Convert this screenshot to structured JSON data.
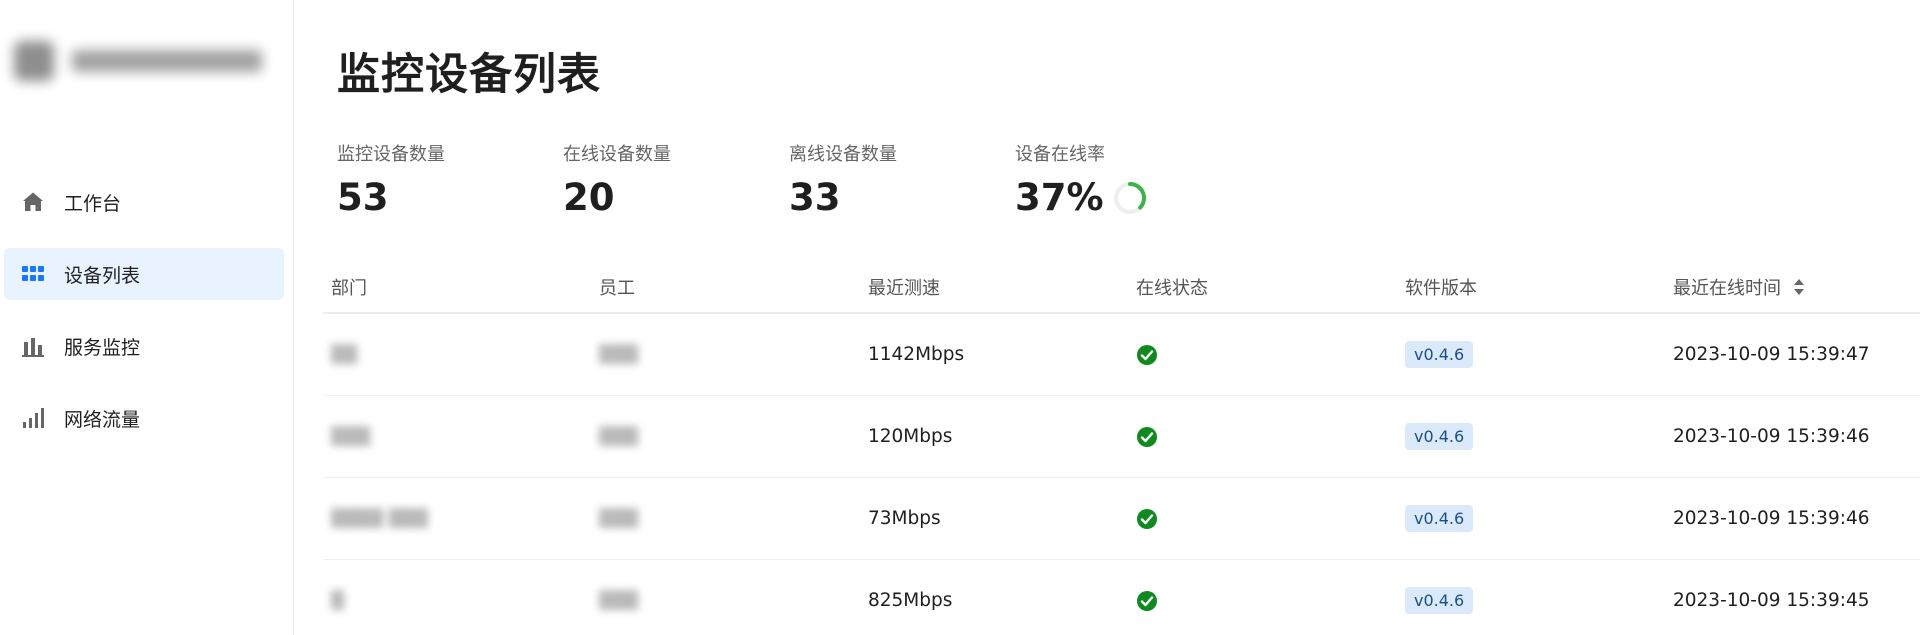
{
  "sidebar": {
    "logo_text": "",
    "items": [
      {
        "label": "工作台",
        "icon": "home-icon",
        "active": false
      },
      {
        "label": "设备列表",
        "icon": "grid-icon",
        "active": true
      },
      {
        "label": "服务监控",
        "icon": "bar-chart-icon",
        "active": false
      },
      {
        "label": "网络流量",
        "icon": "signal-icon",
        "active": false
      }
    ]
  },
  "colors": {
    "accent": "#1677ff",
    "active_bg": "#e8f3ff",
    "success": "#0f8a1e",
    "ring": "#3cb34a",
    "badge_bg": "#dbeafb"
  },
  "page": {
    "title": "监控设备列表"
  },
  "stats": [
    {
      "label": "监控设备数量",
      "value": "53"
    },
    {
      "label": "在线设备数量",
      "value": "20"
    },
    {
      "label": "离线设备数量",
      "value": "33"
    },
    {
      "label": "设备在线率",
      "value": "37%",
      "fraction": 0.37
    }
  ],
  "table": {
    "headers": [
      "部门",
      "员工",
      "最近测速",
      "在线状态",
      "软件版本",
      "最近在线时间"
    ],
    "rows": [
      {
        "dept": "▒▒",
        "employee": "▒▒▒",
        "speed": "1142Mbps",
        "online": true,
        "version": "v0.4.6",
        "last_online": "2023-10-09 15:39:47"
      },
      {
        "dept": "▒▒▒",
        "employee": "▒▒▒",
        "speed": "120Mbps",
        "online": true,
        "version": "v0.4.6",
        "last_online": "2023-10-09 15:39:46"
      },
      {
        "dept": "▒▒▒▒ ▒▒▒",
        "employee": "▒▒▒",
        "speed": "73Mbps",
        "online": true,
        "version": "v0.4.6",
        "last_online": "2023-10-09 15:39:46"
      },
      {
        "dept": "▒",
        "employee": "▒▒▒",
        "speed": "825Mbps",
        "online": true,
        "version": "v0.4.6",
        "last_online": "2023-10-09 15:39:45"
      }
    ]
  }
}
